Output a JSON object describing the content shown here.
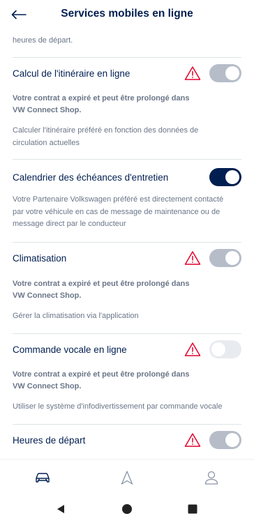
{
  "header": {
    "title": "Services mobiles en ligne",
    "back_icon": "arrow-left-icon"
  },
  "top_fragment": "heures de départ.",
  "services": [
    {
      "title": "Calcul de l'itinéraire en ligne",
      "warning": true,
      "toggle_state": "on-disabled",
      "note": [
        "Votre contrat a expiré et peut être prolongé dans",
        "VW Connect Shop."
      ],
      "description": [
        "Calculer l'itinéraire préféré en fonction des données de",
        "circulation actuelles"
      ]
    },
    {
      "title": "Calendrier des échéances d'entretien",
      "warning": false,
      "toggle_state": "on-active",
      "description": [
        "Votre Partenaire Volkswagen préféré est directement contacté",
        "par votre véhicule en cas de message de maintenance ou de",
        "message direct par le conducteur"
      ]
    },
    {
      "title": "Climatisation",
      "warning": true,
      "toggle_state": "on-disabled",
      "note": [
        "Votre contrat a expiré et peut être prolongé dans",
        "VW Connect Shop."
      ],
      "description": [
        "Gérer la climatisation via l'application"
      ]
    },
    {
      "title": "Commande vocale en ligne",
      "warning": true,
      "toggle_state": "off-disabled",
      "note": [
        "Votre contrat a expiré et peut être prolongé dans",
        "VW Connect Shop."
      ],
      "description": [
        "Utiliser le système d'infodivertissement par commande vocale"
      ]
    },
    {
      "title": "Heures de départ",
      "warning": true,
      "toggle_state": "on-disabled"
    }
  ],
  "bottom_nav": [
    {
      "icon": "car-icon",
      "active": true
    },
    {
      "icon": "navigation-icon",
      "active": false
    },
    {
      "icon": "profile-icon",
      "active": false
    }
  ],
  "system_nav": [
    "back-triangle-icon",
    "home-circle-icon",
    "recents-square-icon"
  ],
  "colors": {
    "primary": "#001e50",
    "warning": "#e4002b",
    "muted": "#6a7688",
    "toggle_disabled": "#b6bdc9"
  }
}
